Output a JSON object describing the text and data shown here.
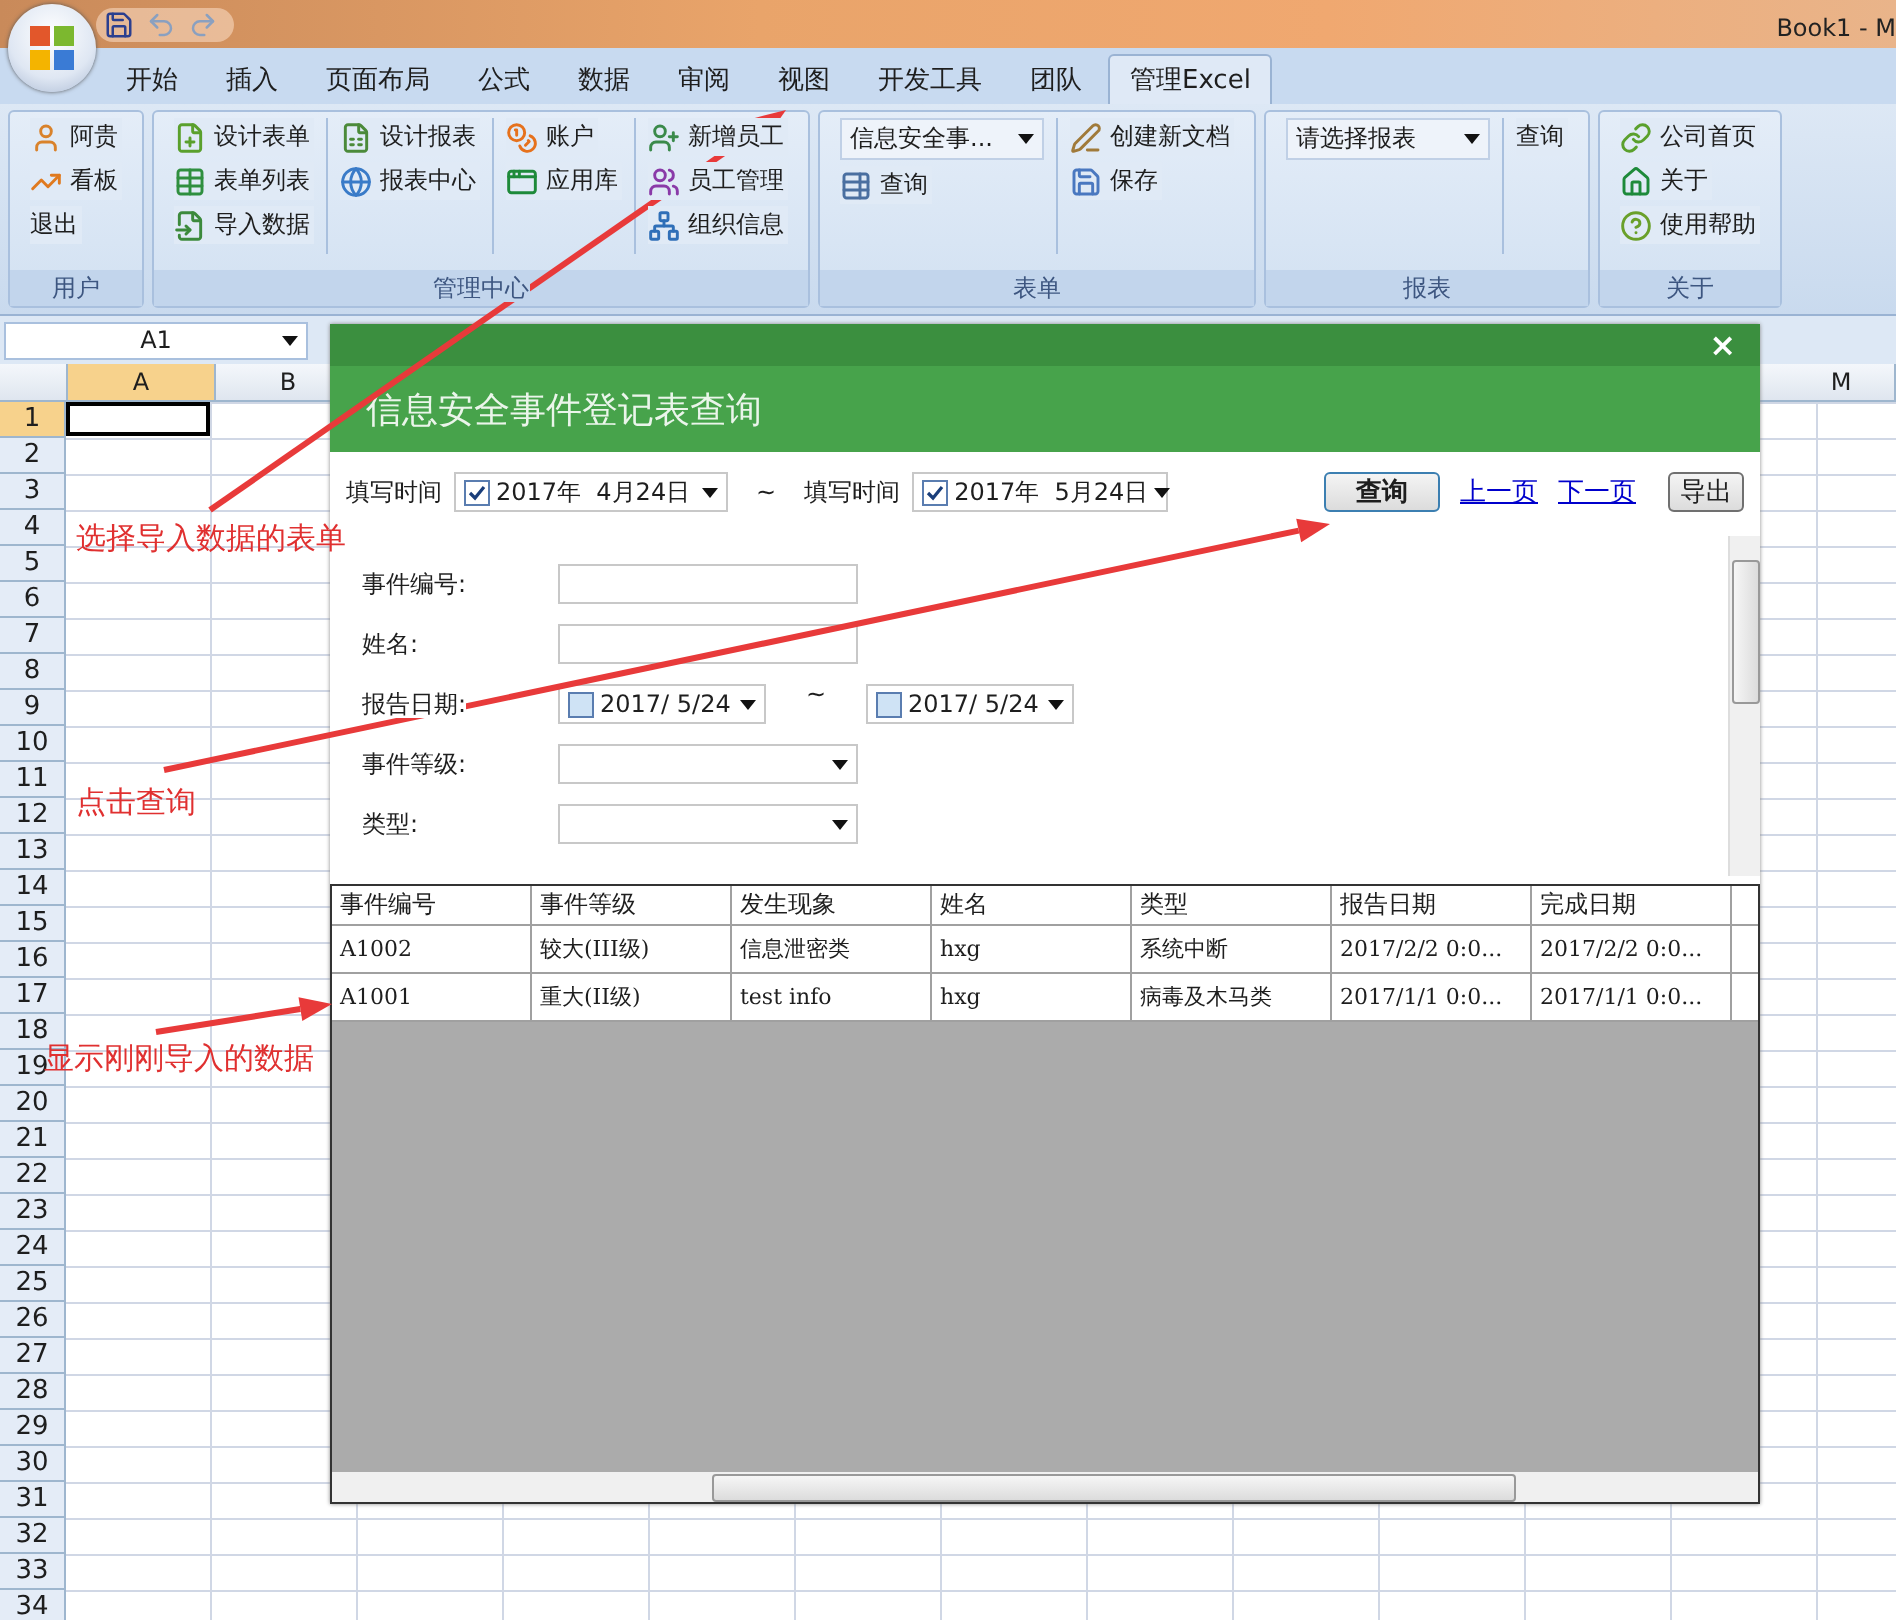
{
  "window": {
    "title": "Book1 - M"
  },
  "ribbon": {
    "tabs": [
      {
        "label": "开始",
        "selected": false
      },
      {
        "label": "插入",
        "selected": false
      },
      {
        "label": "页面布局",
        "selected": false
      },
      {
        "label": "公式",
        "selected": false
      },
      {
        "label": "数据",
        "selected": false
      },
      {
        "label": "审阅",
        "selected": false
      },
      {
        "label": "视图",
        "selected": false
      },
      {
        "label": "开发工具",
        "selected": false
      },
      {
        "label": "团队",
        "selected": false
      },
      {
        "label": "管理Excel",
        "selected": true
      }
    ],
    "groups": [
      {
        "label": "用户",
        "columns": [
          {
            "items": [
              {
                "kind": "button",
                "label": "阿贵",
                "icon": true
              },
              {
                "kind": "button",
                "label": "看板",
                "icon": true
              },
              {
                "kind": "button",
                "label": "退出",
                "icon": false
              }
            ]
          }
        ]
      },
      {
        "label": "管理中心",
        "columns": [
          {
            "items": [
              {
                "kind": "button",
                "label": "设计表单",
                "icon": true
              },
              {
                "kind": "button",
                "label": "表单列表",
                "icon": true
              },
              {
                "kind": "button",
                "label": "导入数据",
                "icon": true
              }
            ]
          },
          {
            "items": [
              {
                "kind": "button",
                "label": "设计报表",
                "icon": true
              },
              {
                "kind": "button",
                "label": "报表中心",
                "icon": true
              }
            ]
          },
          {
            "items": [
              {
                "kind": "button",
                "label": "账户",
                "icon": true
              },
              {
                "kind": "button",
                "label": "应用库",
                "icon": true
              }
            ]
          },
          {
            "items": [
              {
                "kind": "button",
                "label": "新增员工",
                "icon": true
              },
              {
                "kind": "button",
                "label": "员工管理",
                "icon": true
              },
              {
                "kind": "button",
                "label": "组织信息",
                "icon": true
              }
            ]
          }
        ]
      },
      {
        "label": "表单",
        "columns": [
          {
            "items": [
              {
                "kind": "combo",
                "label": "信息安全事..."
              },
              {
                "kind": "button",
                "label": "查询",
                "icon": true
              }
            ]
          },
          {
            "items": [
              {
                "kind": "button",
                "label": "创建新文档",
                "icon": true
              },
              {
                "kind": "button",
                "label": "保存",
                "icon": true
              }
            ]
          }
        ]
      },
      {
        "label": "报表",
        "columns": [
          {
            "items": [
              {
                "kind": "combo",
                "label": "请选择报表"
              }
            ]
          },
          {
            "items": [
              {
                "kind": "button",
                "label": "查询",
                "icon": false
              }
            ]
          }
        ]
      },
      {
        "label": "关于",
        "columns": [
          {
            "items": [
              {
                "kind": "button",
                "label": "公司首页",
                "icon": true
              },
              {
                "kind": "button",
                "label": "关于",
                "icon": true
              },
              {
                "kind": "button",
                "label": "使用帮助",
                "icon": true
              }
            ]
          }
        ]
      }
    ]
  },
  "name_box": "A1",
  "sheet": {
    "columns": [
      {
        "label": "A",
        "selected": true
      },
      {
        "label": "B",
        "selected": false
      },
      {
        "label": "M",
        "selected": false
      }
    ],
    "rows": [
      {
        "label": "1",
        "selected": true
      },
      {
        "label": "2",
        "selected": false
      },
      {
        "label": "3",
        "selected": false
      },
      {
        "label": "4",
        "selected": false
      },
      {
        "label": "5",
        "selected": false
      },
      {
        "label": "6",
        "selected": false
      },
      {
        "label": "7",
        "selected": false
      },
      {
        "label": "8",
        "selected": false
      },
      {
        "label": "9",
        "selected": false
      },
      {
        "label": "10",
        "selected": false
      },
      {
        "label": "11",
        "selected": false
      },
      {
        "label": "12",
        "selected": false
      },
      {
        "label": "13",
        "selected": false
      },
      {
        "label": "14",
        "selected": false
      },
      {
        "label": "15",
        "selected": false
      },
      {
        "label": "16",
        "selected": false
      },
      {
        "label": "17",
        "selected": false
      },
      {
        "label": "18",
        "selected": false
      },
      {
        "label": "19",
        "selected": false
      },
      {
        "label": "20",
        "selected": false
      },
      {
        "label": "21",
        "selected": false
      },
      {
        "label": "22",
        "selected": false
      },
      {
        "label": "23",
        "selected": false
      },
      {
        "label": "24",
        "selected": false
      },
      {
        "label": "25",
        "selected": false
      },
      {
        "label": "26",
        "selected": false
      },
      {
        "label": "27",
        "selected": false
      },
      {
        "label": "28",
        "selected": false
      },
      {
        "label": "29",
        "selected": false
      },
      {
        "label": "30",
        "selected": false
      },
      {
        "label": "31",
        "selected": false
      },
      {
        "label": "32",
        "selected": false
      },
      {
        "label": "33",
        "selected": false
      },
      {
        "label": "34",
        "selected": false
      }
    ]
  },
  "dialog": {
    "title": "信息安全事件登记表查询",
    "close": "×",
    "filter": {
      "from_label": "填写时间",
      "from": {
        "value": "2017年  4月24日",
        "checked": true
      },
      "separator": "~",
      "to_label": "填写时间",
      "to": {
        "value": "2017年  5月24日",
        "checked": true
      }
    },
    "query_button": "查询",
    "links": [
      "上一页",
      "下一页"
    ],
    "export_button": "导出",
    "form": [
      {
        "kind": "text",
        "label": "事件编号:"
      },
      {
        "kind": "text",
        "label": "姓名:"
      },
      {
        "kind": "date_range",
        "label": "报告日期:",
        "from": {
          "value": "2017/ 5/24",
          "checked": false
        },
        "separator": "~",
        "to": {
          "value": "2017/ 5/24",
          "checked": false
        }
      },
      {
        "kind": "combo",
        "label": "事件等级:"
      },
      {
        "kind": "combo",
        "label": "类型:"
      }
    ],
    "table": {
      "columns": [
        "事件编号",
        "事件等级",
        "发生现象",
        "姓名",
        "类型",
        "报告日期",
        "完成日期"
      ],
      "rows": [
        [
          "A1002",
          "较大(III级)",
          "信息泄密类",
          "hxg",
          "系统中断",
          "2017/2/2 0:0...",
          "2017/2/2 0:0..."
        ],
        [
          "A1001",
          "重大(II级)",
          "test info",
          "hxg",
          "病毒及木马类",
          "2017/1/1 0:0...",
          "2017/1/1 0:0..."
        ]
      ]
    }
  },
  "annotations": [
    {
      "text": "选择导入数据的表单"
    },
    {
      "text": "点击查询"
    },
    {
      "text": "显示刚刚导入的数据"
    }
  ]
}
